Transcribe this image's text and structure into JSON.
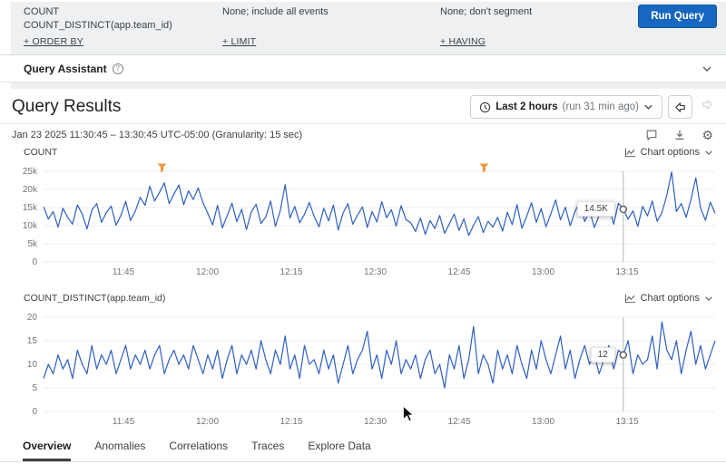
{
  "query_builder": {
    "visualize": [
      "COUNT",
      "COUNT_DISTINCT(app.team_id)"
    ],
    "where": "None; include all events",
    "group_by": "None; don't segment",
    "run_button": "Run Query",
    "order_by": "+ ORDER BY",
    "limit": "+ LIMIT",
    "having": "+ HAVING"
  },
  "query_assistant": {
    "label": "Query Assistant",
    "info_glyph": "?"
  },
  "results": {
    "title": "Query Results",
    "time_range": "Last 2 hours",
    "time_range_note": "(run 31 min ago)",
    "date_range": "Jan 23 2025 11:30:45 – 13:30:45 UTC-05:00 (Granularity: 15 sec)"
  },
  "icons": {
    "gear": "⚙"
  },
  "tabs": [
    {
      "label": "Overview",
      "active": true
    },
    {
      "label": "Anomalies",
      "active": false
    },
    {
      "label": "Correlations",
      "active": false
    },
    {
      "label": "Traces",
      "active": false
    },
    {
      "label": "Explore Data",
      "active": false
    }
  ],
  "chart_data": [
    {
      "type": "line",
      "title": "COUNT",
      "chart_options_label": "Chart options",
      "line_color": "#2e5fc2",
      "x_start": "11:30:45",
      "x_end": "13:30:45",
      "x_ticks": [
        "11:45",
        "12:00",
        "12:15",
        "12:30",
        "12:45",
        "13:00",
        "13:15"
      ],
      "x_tick_fractions": [
        0.119,
        0.244,
        0.369,
        0.494,
        0.619,
        0.744,
        0.869
      ],
      "y_ticks": [
        "25k",
        "20k",
        "15k",
        "10k",
        "5k",
        "0"
      ],
      "ylim": [
        0,
        25000
      ],
      "grid": true,
      "hover": {
        "index": 120,
        "label": "14.5K"
      },
      "markers": [
        {
          "type": "trigger",
          "fraction": 0.176
        },
        {
          "type": "trigger",
          "fraction": 0.655
        }
      ],
      "values": [
        15200,
        11800,
        13900,
        9600,
        14800,
        12300,
        10400,
        15700,
        13200,
        9100,
        14300,
        16100,
        10900,
        13600,
        15400,
        10100,
        12800,
        16700,
        11400,
        14100,
        17800,
        15600,
        20900,
        16800,
        19200,
        21800,
        16100,
        18700,
        21200,
        15800,
        19600,
        17200,
        20400,
        16300,
        13400,
        10200,
        15600,
        9400,
        12700,
        16200,
        11100,
        14500,
        8900,
        13800,
        15900,
        10600,
        12400,
        16800,
        9800,
        14200,
        21300,
        12100,
        15300,
        10800,
        13100,
        16400,
        12600,
        9700,
        14800,
        11300,
        15700,
        8800,
        13500,
        16100,
        10400,
        12900,
        15200,
        9500,
        13900,
        11000,
        16600,
        12200,
        14400,
        9900,
        15500,
        11700,
        10800,
        8400,
        12100,
        7600,
        11400,
        9200,
        12800,
        7900,
        10500,
        13200,
        8700,
        11900,
        7300,
        10100,
        12500,
        8100,
        11200,
        9600,
        12300,
        8500,
        13700,
        10300,
        15800,
        9300,
        12600,
        16300,
        10900,
        14700,
        9700,
        13300,
        17100,
        11600,
        15100,
        10000,
        13900,
        16600,
        11100,
        14300,
        9500,
        12800,
        13200,
        15600,
        10400,
        16200,
        14500,
        11800,
        14100,
        9800,
        15300,
        12700,
        16800,
        11200,
        13600,
        18400,
        24800,
        13900,
        16100,
        12300,
        17200,
        23200,
        14800,
        11500,
        16500,
        13400
      ]
    },
    {
      "type": "line",
      "title": "COUNT_DISTINCT(app.team_id)",
      "chart_options_label": "Chart options",
      "line_color": "#2e5fc2",
      "x_start": "11:30:45",
      "x_end": "13:30:45",
      "x_ticks": [
        "11:45",
        "12:00",
        "12:15",
        "12:30",
        "12:45",
        "13:00",
        "13:15"
      ],
      "x_tick_fractions": [
        0.119,
        0.244,
        0.369,
        0.494,
        0.619,
        0.744,
        0.869
      ],
      "y_ticks": [
        "20",
        "15",
        "10",
        "5",
        "0"
      ],
      "ylim": [
        0,
        20
      ],
      "grid": true,
      "hover": {
        "index": 120,
        "label": "12"
      },
      "markers": [],
      "values": [
        7,
        10,
        8,
        12,
        9,
        11,
        7,
        13,
        10,
        8,
        14,
        9,
        12,
        10,
        13,
        8,
        11,
        14,
        9,
        12,
        10,
        13,
        9,
        12,
        14,
        8,
        11,
        13,
        10,
        12,
        9,
        14,
        11,
        8,
        12,
        9,
        13,
        7,
        11,
        14,
        8,
        12,
        10,
        13,
        9,
        15,
        11,
        8,
        13,
        10,
        16,
        9,
        12,
        7,
        14,
        10,
        11,
        8,
        13,
        9,
        12,
        6,
        10,
        14,
        8,
        11,
        13,
        17,
        9,
        12,
        7,
        13,
        10,
        15,
        8,
        11,
        9,
        12,
        7,
        11,
        13,
        8,
        10,
        5,
        12,
        9,
        14,
        7,
        11,
        18,
        8,
        12,
        10,
        6,
        13,
        9,
        12,
        8,
        14,
        10,
        7,
        13,
        9,
        15,
        11,
        8,
        12,
        16,
        9,
        13,
        7,
        11,
        14,
        10,
        12,
        8,
        11,
        14,
        9,
        13,
        12,
        15,
        8,
        12,
        10,
        11,
        16,
        9,
        19,
        13,
        11,
        15,
        8,
        13,
        17,
        10,
        14,
        9,
        12,
        15
      ]
    }
  ]
}
